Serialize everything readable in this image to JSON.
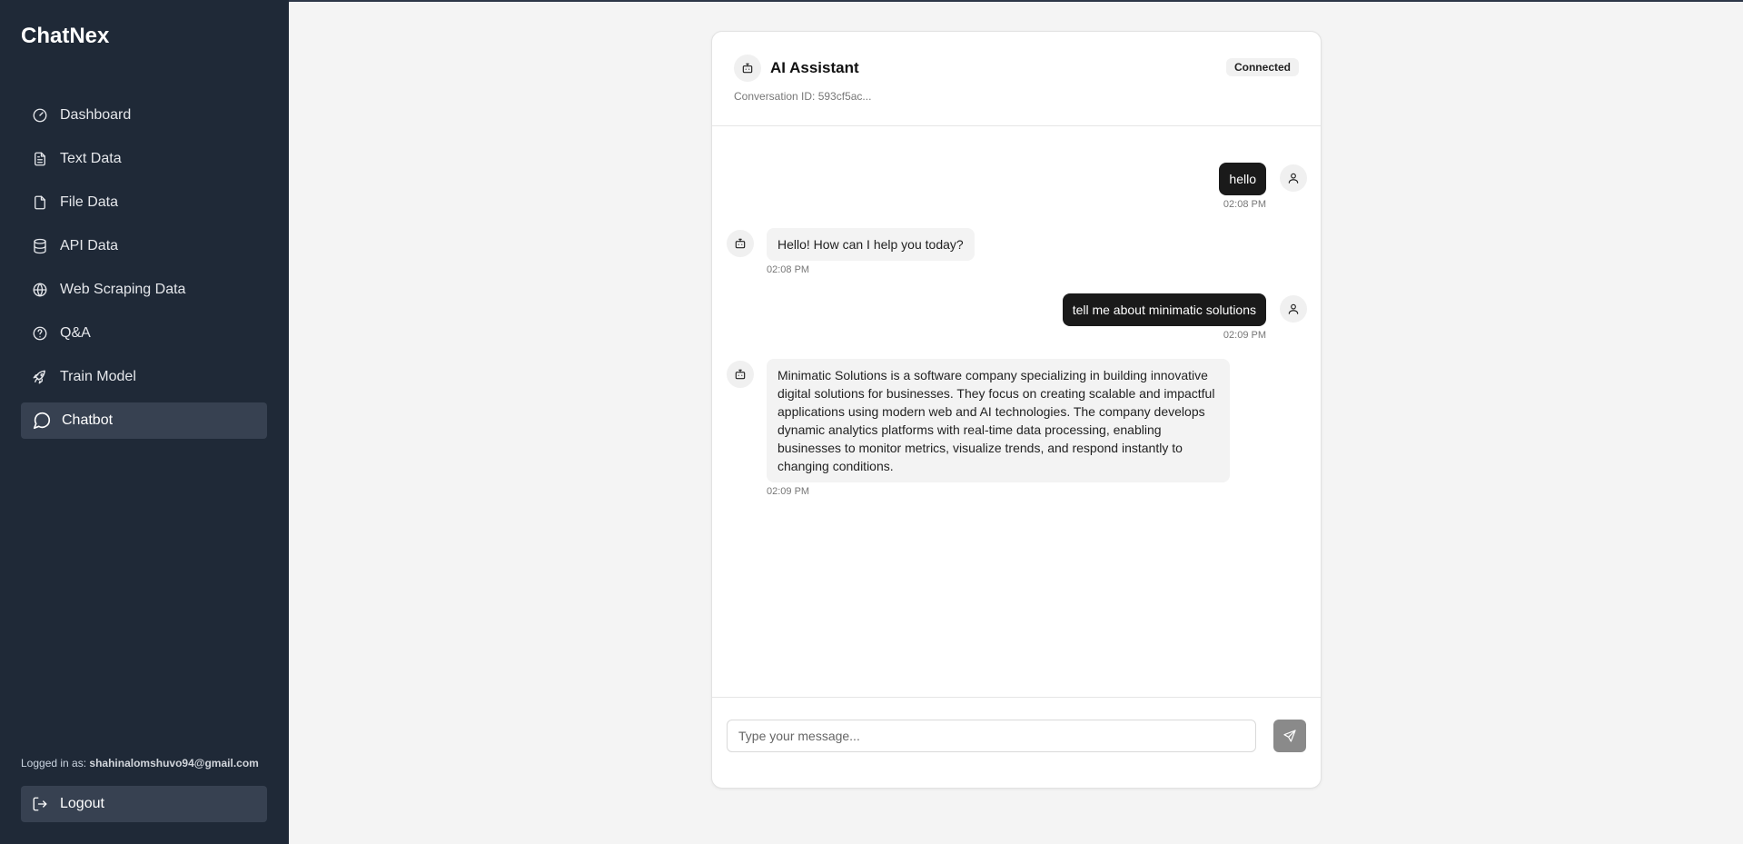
{
  "app": {
    "brand": "ChatNex"
  },
  "sidebar": {
    "items": [
      {
        "label": "Dashboard",
        "icon": "gauge-icon",
        "active": false
      },
      {
        "label": "Text Data",
        "icon": "file-text-icon",
        "active": false
      },
      {
        "label": "File Data",
        "icon": "file-icon",
        "active": false
      },
      {
        "label": "API Data",
        "icon": "database-icon",
        "active": false
      },
      {
        "label": "Web Scraping Data",
        "icon": "globe-icon",
        "active": false
      },
      {
        "label": "Q&A",
        "icon": "help-circle-icon",
        "active": false
      },
      {
        "label": "Train Model",
        "icon": "rocket-icon",
        "active": false
      },
      {
        "label": "Chatbot",
        "icon": "message-circle-icon",
        "active": true
      }
    ],
    "logged_in_label": "Logged in as:",
    "user_email": "shahinalomshuvo94@gmail.com",
    "logout_label": "Logout"
  },
  "chat": {
    "title": "AI Assistant",
    "conversation_id": "Conversation ID: 593cf5ac...",
    "status": "Connected",
    "messages": [
      {
        "role": "user",
        "text": "hello",
        "time": "02:08 PM"
      },
      {
        "role": "bot",
        "text": "Hello! How can I help you today?",
        "time": "02:08 PM"
      },
      {
        "role": "user",
        "text": "tell me about minimatic solutions",
        "time": "02:09 PM"
      },
      {
        "role": "bot",
        "text": "Minimatic Solutions is a software company specializing in building innovative digital solutions for businesses. They focus on creating scalable and impactful applications using modern web and AI technologies. The company develops dynamic analytics platforms with real-time data processing, enabling businesses to monitor metrics, visualize trends, and respond instantly to changing conditions.",
        "time": "02:09 PM"
      }
    ],
    "input_placeholder": "Type your message...",
    "input_value": ""
  },
  "colors": {
    "sidebar_bg": "#1f2937",
    "sidebar_active": "#374151",
    "user_bubble": "#1a1a1a",
    "bot_bubble": "#f3f3f3",
    "send_button": "#8a8a8a",
    "page_bg": "#f4f4f4"
  }
}
